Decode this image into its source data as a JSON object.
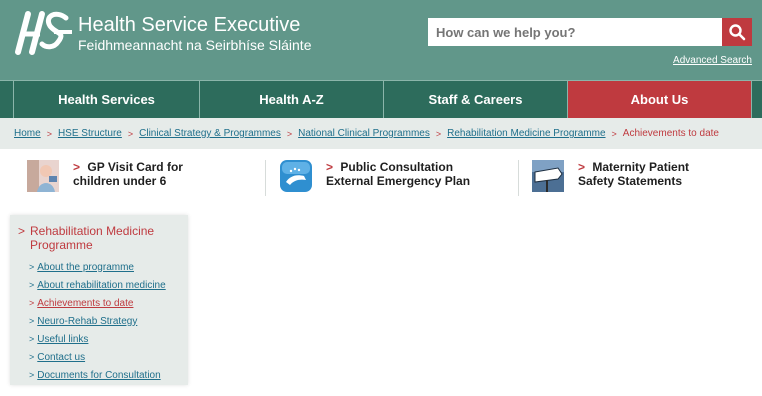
{
  "header": {
    "org_name": "Health Service Executive",
    "org_subtitle": "Feidhmeannacht na Seirbhíse Sláinte",
    "search_placeholder": "How can we help you?",
    "advanced_search": "Advanced Search",
    "logo_icon": "hse-logo"
  },
  "nav": {
    "items": [
      {
        "label": "Health Services"
      },
      {
        "label": "Health A-Z"
      },
      {
        "label": "Staff & Careers"
      },
      {
        "label": "About Us",
        "active": true
      }
    ]
  },
  "breadcrumb": {
    "items": [
      "Home",
      "HSE Structure",
      "Clinical Strategy & Programmes",
      "National Clinical Programmes",
      "Rehabilitation Medicine Programme",
      "Achievements to date"
    ]
  },
  "promos": [
    {
      "label": "GP Visit Card for children under 6",
      "icon": "child-photo"
    },
    {
      "label": "Public Consultation External Emergency Plan",
      "icon": "hand-icon"
    },
    {
      "label": "Maternity Patient Safety Statements",
      "icon": "maternity-sign-photo"
    }
  ],
  "sidemenu": {
    "title": "Rehabilitation Medicine Programme",
    "links": [
      {
        "label": "About the programme"
      },
      {
        "label": "About rehabilitation medicine"
      },
      {
        "label": "Achievements to date",
        "current": true
      },
      {
        "label": "Neuro-Rehab Strategy"
      },
      {
        "label": "Useful links"
      },
      {
        "label": "Contact us"
      },
      {
        "label": "Documents for Consultation"
      }
    ]
  },
  "colors": {
    "header_bg": "#61978a",
    "nav_bg": "#2d6c5c",
    "accent_red": "#bf3a3f",
    "link_blue": "#1f6f8b",
    "panel_bg": "#e6ebe9"
  }
}
